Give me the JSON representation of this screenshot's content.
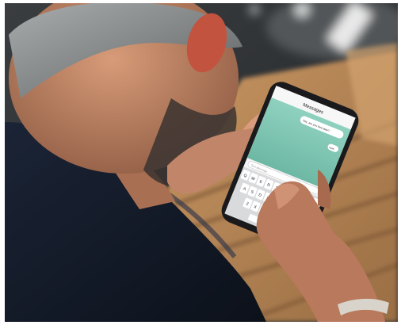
{
  "photo": {
    "subject": "person-texting-on-smartphone",
    "colors": {
      "floor_dark": "#2b2e31",
      "floor_wood": "#b98a5a",
      "shirt": "#141c2a",
      "skin": "#c58a6a",
      "hair": "#8a8d8e",
      "phone_body": "#1a1a1c",
      "chat_background": "#7fc6b3",
      "keyboard": "#d9dadc"
    }
  },
  "phone_screen": {
    "header_title": "Messages",
    "outgoing_bubble_text": "hey, are you free later?",
    "reply_bubble_text": "sure",
    "compose_placeholder": "Text Message",
    "keyboard_rows": [
      [
        "Q",
        "W",
        "E",
        "R",
        "T",
        "Y",
        "U",
        "I",
        "O",
        "P"
      ],
      [
        "A",
        "S",
        "D",
        "F",
        "G",
        "H",
        "J",
        "K",
        "L"
      ],
      [
        "Z",
        "X",
        "C",
        "V",
        "B",
        "N",
        "M"
      ]
    ],
    "space_label": "space",
    "return_label": "return"
  }
}
